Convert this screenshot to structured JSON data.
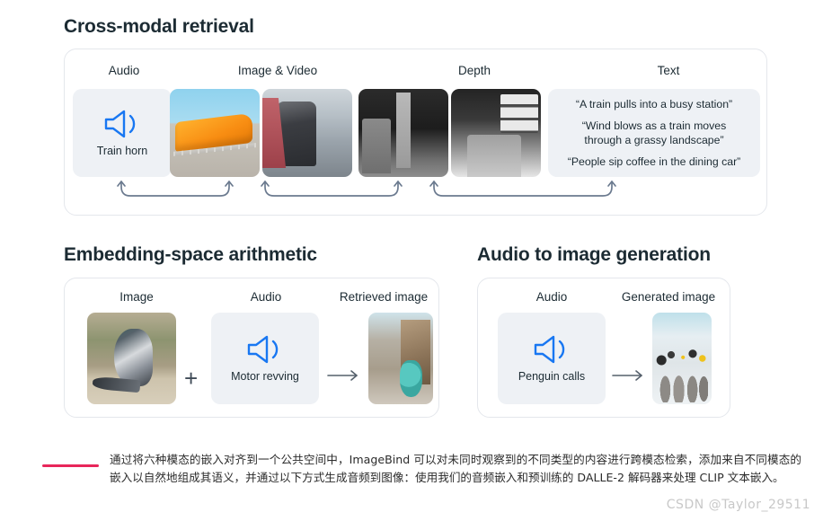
{
  "sections": {
    "cross_modal": {
      "title": "Cross-modal retrieval",
      "columns": [
        {
          "label": "Audio"
        },
        {
          "label": "Image & Video"
        },
        {
          "label": "Depth"
        },
        {
          "label": "Text"
        }
      ],
      "audio_tile": {
        "icon": "speaker-icon",
        "label": "Train horn"
      },
      "image_tiles": [
        {
          "alt": "orange elevated train"
        },
        {
          "alt": "red commuter train with cyclist on platform"
        }
      ],
      "depth_tiles": [
        {
          "alt": "depth map of railroad crossing sign"
        },
        {
          "alt": "depth map of train platform"
        }
      ],
      "text_quotes": [
        "“A train pulls into a busy station”",
        "“Wind blows as a train moves\nthrough a grassy landscape”",
        "“People sip coffee in the dining car”"
      ]
    },
    "embedding_arithmetic": {
      "title": "Embedding-space arithmetic",
      "columns": [
        {
          "label": "Image"
        },
        {
          "label": "Audio"
        },
        {
          "label": "Retrieved image"
        }
      ],
      "image_tile": {
        "alt": "pigeon standing on a ledge"
      },
      "audio_tile": {
        "icon": "speaker-icon",
        "label": "Motor revving"
      },
      "result_tile": {
        "alt": "person on teal scooter with flying pigeons"
      },
      "plus_symbol": "+",
      "arrow_symbol": "arrow-right-icon"
    },
    "audio_to_image": {
      "title": "Audio to image generation",
      "columns": [
        {
          "label": "Audio"
        },
        {
          "label": "Generated image"
        }
      ],
      "audio_tile": {
        "icon": "speaker-icon",
        "label": "Penguin calls"
      },
      "result_tile": {
        "alt": "group of penguin chicks on snow"
      },
      "arrow_symbol": "arrow-right-icon"
    }
  },
  "caption": {
    "text": "通过将六种模态的嵌入对齐到一个公共空间中，ImageBind 可以对未同时观察到的不同类型的内容进行跨模态检索，添加来自不同模态的嵌入以自然地组成其语义，并通过以下方式生成音频到图像：使用我们的音频嵌入和预训练的 DALLE-2 解码器来处理 CLIP 文本嵌入。",
    "rule_color": "#e8265a"
  },
  "watermark": "CSDN @Taylor_29511",
  "colors": {
    "accent_blue": "#1877f2",
    "tile_bg": "#eef1f5",
    "card_border": "#e4e7ec",
    "arrow": "#6b7a8f",
    "text": "#1c2b33"
  }
}
